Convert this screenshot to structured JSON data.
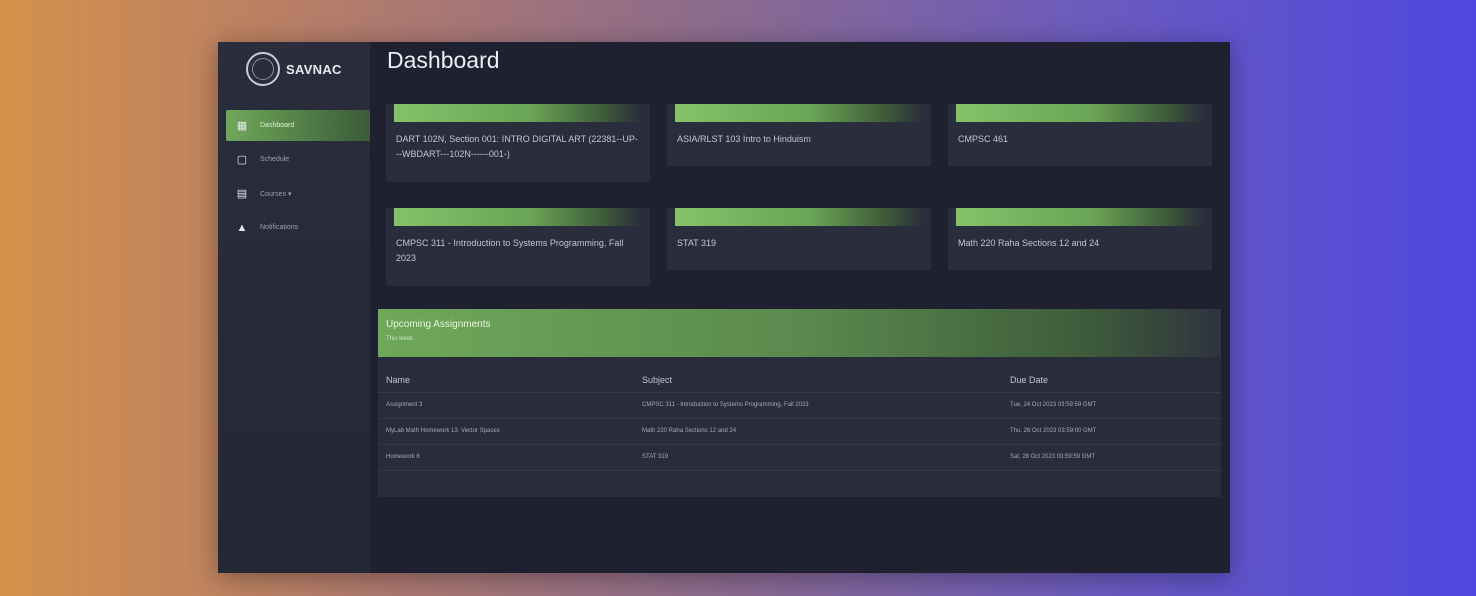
{
  "brand": {
    "name": "SAVNAC"
  },
  "sidebar": {
    "items": [
      {
        "label": "Dashboard",
        "icon": "grid-icon",
        "active": true
      },
      {
        "label": "Schedule",
        "icon": "calendar-icon",
        "active": false
      },
      {
        "label": "Courses ▾",
        "icon": "book-icon",
        "active": false
      },
      {
        "label": "Notifications",
        "icon": "bell-icon",
        "active": false
      }
    ]
  },
  "main": {
    "title": "Dashboard",
    "courses": [
      {
        "name": "DART 102N, Section 001: INTRO DIGITAL ART (22381--UP---WBDART---102N------001-)"
      },
      {
        "name": "ASIA/RLST 103 Intro to Hinduism"
      },
      {
        "name": "CMPSC 461"
      },
      {
        "name": "CMPSC 311 - Introduction to Systems Programming, Fall 2023"
      },
      {
        "name": "STAT 319"
      },
      {
        "name": "Math 220 Raha Sections 12 and 24"
      }
    ],
    "assignments": {
      "title": "Upcoming Assignments",
      "subtitle": "This week",
      "columns": [
        "Name",
        "Subject",
        "Due Date"
      ],
      "rows": [
        [
          "Assignment 3",
          "CMPSC 311 - Introduction to Systems Programming, Fall 2023",
          "Tue, 24 Oct 2023 03:59:59 GMT"
        ],
        [
          "MyLab Math Homework 13: Vector Spaces",
          "Math 220 Raha Sections 12 and 24",
          "Thu, 26 Oct 2023 03:59:00 GMT"
        ],
        [
          "Homework 6",
          "STAT 319",
          "Sat, 28 Oct 2023 03:59:59 GMT"
        ]
      ]
    }
  },
  "colors": {
    "accent_green": "#6fa85a",
    "panel": "#2a2d3b",
    "app_bg": "#1f2130"
  }
}
